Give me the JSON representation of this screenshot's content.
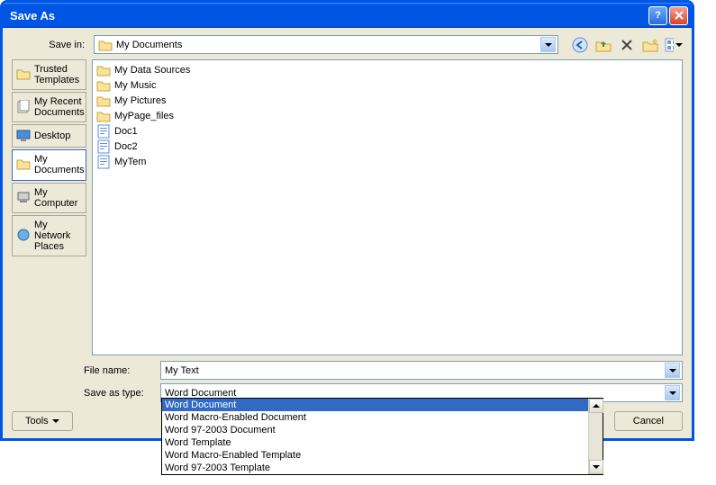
{
  "title": "Save As",
  "savein_label": "Save in:",
  "savein_value": "My Documents",
  "places": [
    {
      "label": "Trusted Templates",
      "icon": "folder"
    },
    {
      "label": "My Recent Documents",
      "icon": "docs"
    },
    {
      "label": "Desktop",
      "icon": "desktop"
    },
    {
      "label": "My Documents",
      "icon": "folder",
      "selected": true
    },
    {
      "label": "My Computer",
      "icon": "computer"
    },
    {
      "label": "My Network Places",
      "icon": "network"
    }
  ],
  "files": [
    {
      "name": "My Data Sources",
      "type": "folder-special"
    },
    {
      "name": "My Music",
      "type": "folder"
    },
    {
      "name": "My Pictures",
      "type": "folder"
    },
    {
      "name": "MyPage_files",
      "type": "folder"
    },
    {
      "name": "Doc1",
      "type": "doc"
    },
    {
      "name": "Doc2",
      "type": "doc"
    },
    {
      "name": "MyTem",
      "type": "doc"
    }
  ],
  "filename_label": "File name:",
  "filename_value": "My Text",
  "saveastype_label": "Save as type:",
  "saveastype_value": "Word Document",
  "dropdown_items": [
    "Word Document",
    "Word Macro-Enabled Document",
    "Word 97-2003 Document",
    "Word Template",
    "Word Macro-Enabled Template",
    "Word 97-2003 Template"
  ],
  "dropdown_selected_index": 0,
  "tools_label": "Tools",
  "cancel_label": "Cancel"
}
